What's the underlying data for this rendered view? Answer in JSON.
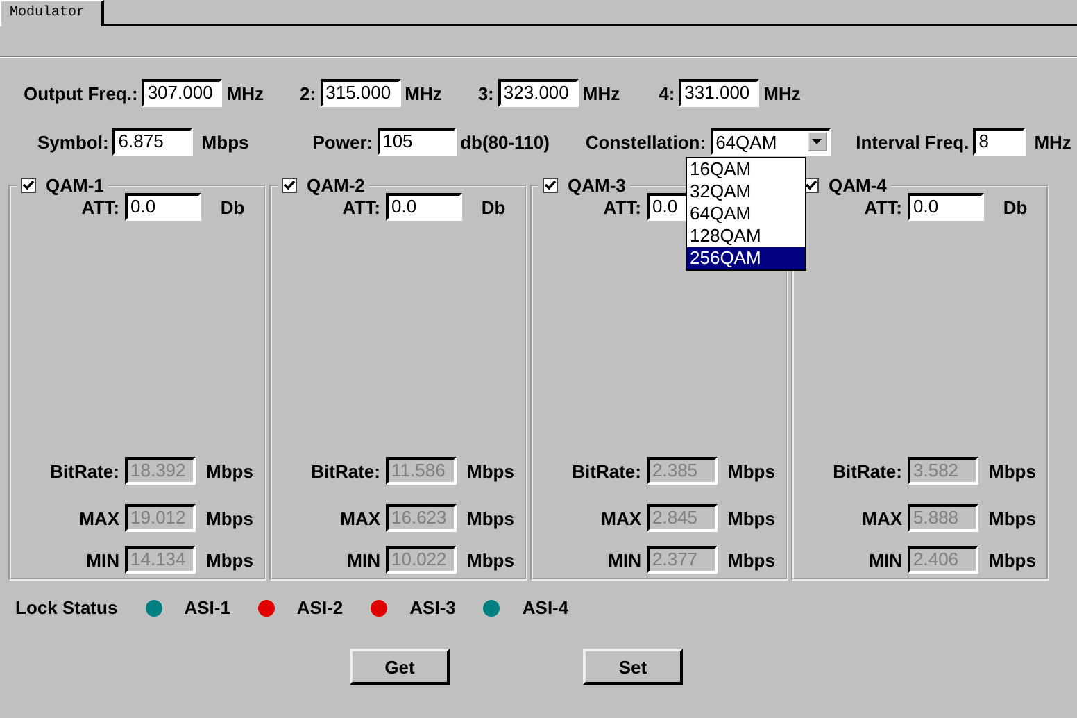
{
  "tabs": [
    {
      "label": "Modulator",
      "selected": true
    }
  ],
  "output_freqs": [
    {
      "label": "Output Freq.:",
      "value": "307.000",
      "unit": "MHz"
    },
    {
      "label": "2:",
      "value": "315.000",
      "unit": "MHz"
    },
    {
      "label": "3:",
      "value": "323.000",
      "unit": "MHz"
    },
    {
      "label": "4:",
      "value": "331.000",
      "unit": "MHz"
    }
  ],
  "settings": [
    {
      "kind": "input",
      "label": "Symbol:",
      "value": "6.875",
      "unit": "Mbps"
    },
    {
      "kind": "input",
      "label": "Power:",
      "value": "105",
      "unit": "db(80-110)"
    },
    {
      "kind": "select",
      "label": "Constellation:",
      "value": "64QAM"
    },
    {
      "kind": "input",
      "label": "Interval Freq.",
      "value": "8",
      "unit": "MHz"
    }
  ],
  "dropdown_options": [
    {
      "label": "16QAM",
      "selected": false
    },
    {
      "label": "32QAM",
      "selected": false
    },
    {
      "label": "64QAM",
      "selected": false
    },
    {
      "label": "128QAM",
      "selected": false
    },
    {
      "label": "256QAM",
      "selected": true
    }
  ],
  "channels": [
    {
      "name": "QAM-1",
      "checked": true,
      "att": {
        "label": "ATT:",
        "value": "0.0",
        "unit": "Db"
      },
      "stats": [
        {
          "label": "BitRate:",
          "value": "18.392",
          "unit": "Mbps",
          "disabled": true
        },
        {
          "label": "MAX",
          "value": "19.012",
          "unit": "Mbps",
          "disabled": true
        },
        {
          "label": "MIN",
          "value": "14.134",
          "unit": "Mbps",
          "disabled": true
        }
      ]
    },
    {
      "name": "QAM-2",
      "checked": true,
      "att": {
        "label": "ATT:",
        "value": "0.0",
        "unit": "Db"
      },
      "stats": [
        {
          "label": "BitRate:",
          "value": "11.586",
          "unit": "Mbps",
          "disabled": true
        },
        {
          "label": "MAX",
          "value": "16.623",
          "unit": "Mbps",
          "disabled": true
        },
        {
          "label": "MIN",
          "value": "10.022",
          "unit": "Mbps",
          "disabled": true
        }
      ]
    },
    {
      "name": "QAM-3",
      "checked": true,
      "att": {
        "label": "ATT:",
        "value": "0.0"
      },
      "stats": [
        {
          "label": "BitRate:",
          "value": "2.385",
          "unit": "Mbps",
          "disabled": true
        },
        {
          "label": "MAX",
          "value": "2.845",
          "unit": "Mbps",
          "disabled": true
        },
        {
          "label": "MIN",
          "value": "2.377",
          "unit": "Mbps",
          "disabled": true
        }
      ]
    },
    {
      "name": "QAM-4",
      "checked": true,
      "att": {
        "label": "ATT:",
        "value": "0.0",
        "unit": "Db"
      },
      "stats": [
        {
          "label": "BitRate:",
          "value": "3.582",
          "unit": "Mbps",
          "disabled": true
        },
        {
          "label": "MAX",
          "value": "5.888",
          "unit": "Mbps",
          "disabled": true
        },
        {
          "label": "MIN",
          "value": "2.406",
          "unit": "Mbps",
          "disabled": true
        }
      ]
    }
  ],
  "lock_status": {
    "label": "Lock Status",
    "indicators": [
      {
        "label": "ASI-1",
        "color": "#008080"
      },
      {
        "label": "ASI-2",
        "color": "#e00000"
      },
      {
        "label": "ASI-3",
        "color": "#e00000"
      },
      {
        "label": "ASI-4",
        "color": "#008080"
      }
    ]
  },
  "buttons": [
    "Get",
    "Set"
  ]
}
